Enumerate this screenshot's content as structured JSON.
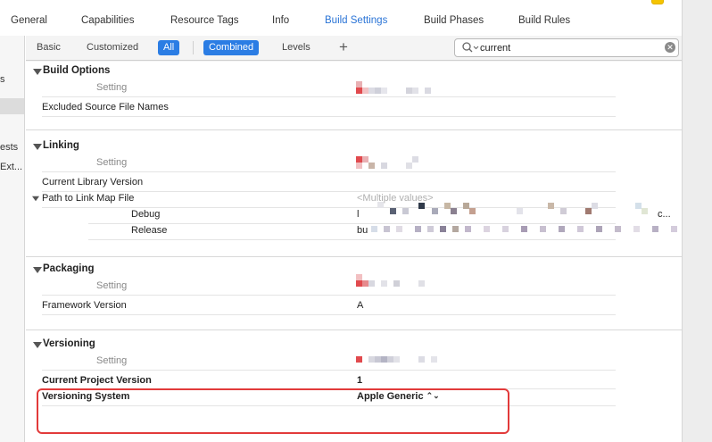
{
  "tabs": [
    {
      "label": "General"
    },
    {
      "label": "Capabilities"
    },
    {
      "label": "Resource Tags"
    },
    {
      "label": "Info"
    },
    {
      "label": "Build Settings"
    },
    {
      "label": "Build Phases"
    },
    {
      "label": "Build Rules"
    }
  ],
  "sidebar": {
    "items": [
      {
        "label": "s"
      },
      {
        "label": "ests"
      },
      {
        "label": "Ext..."
      }
    ]
  },
  "filter": {
    "basic": "Basic",
    "customized": "Customized",
    "all": "All",
    "combined": "Combined",
    "levels": "Levels",
    "add": "+",
    "search_value": "current"
  },
  "sections": {
    "build_options": {
      "title": "Build Options",
      "header": "Setting",
      "rows": [
        {
          "label": "Excluded Source File Names",
          "value": ""
        }
      ]
    },
    "linking": {
      "title": "Linking",
      "header": "Setting",
      "current_library_version": "Current Library Version",
      "path_to_link_map": "Path to Link Map File",
      "path_value": "<Multiple values>",
      "debug_label": "Debug",
      "debug_value_start": "l",
      "debug_value_end": "c...",
      "release_label": "Release",
      "release_value_start": "bu"
    },
    "packaging": {
      "title": "Packaging",
      "header": "Setting",
      "framework_version": "Framework Version",
      "framework_value": "A"
    },
    "versioning": {
      "title": "Versioning",
      "header": "Setting",
      "current_project_version": "Current Project Version",
      "current_project_value": "1",
      "versioning_system": "Versioning System",
      "versioning_system_value": "Apple Generic",
      "stepper": "⌃⌄"
    }
  },
  "colors": {
    "accent": "#2b7de4",
    "active_tab": "#2a74d6",
    "highlight": "#e23a3a"
  }
}
